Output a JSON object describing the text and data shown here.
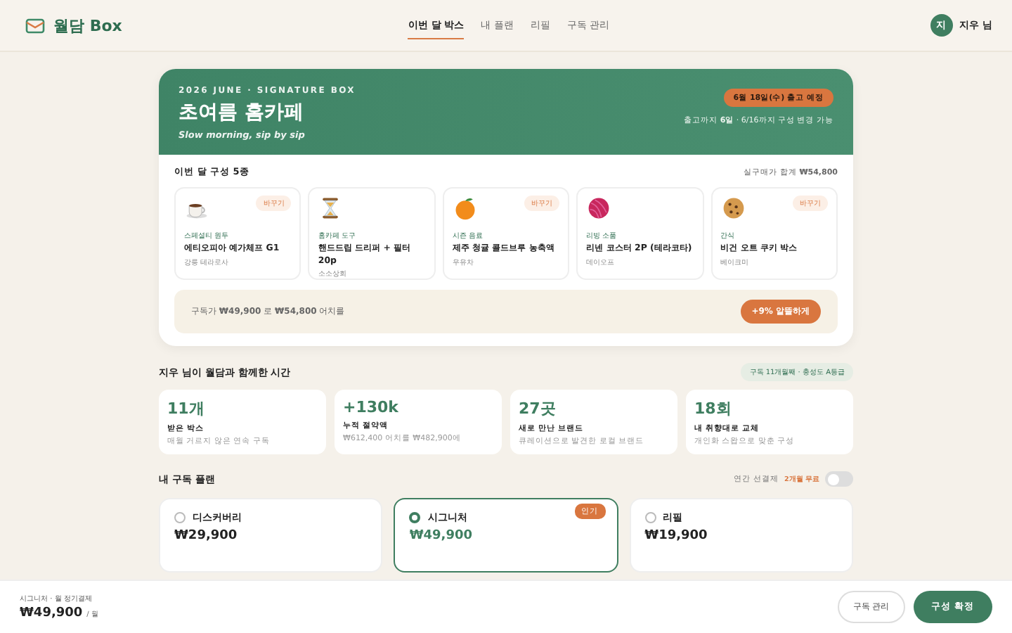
{
  "header": {
    "logo": "월담 Box",
    "nav": [
      {
        "label": "이번 달 박스",
        "selected": true
      },
      {
        "label": "내 플랜",
        "selected": false
      },
      {
        "label": "리필",
        "selected": false
      },
      {
        "label": "구독 관리",
        "selected": false
      }
    ],
    "user": {
      "initial": "지",
      "name": "지우 님"
    }
  },
  "hero": {
    "eyebrow": "2026 JUNE · SIGNATURE BOX",
    "title": "초여름 홈카페",
    "subtitle": "Slow morning, sip by sip",
    "ship_badge": "6월 18일(수) 출고 예정",
    "deadline": "출고까지 **6일** · 6/16까지 구성 변경 가능"
  },
  "box": {
    "heading": "이번 달 구성 5종",
    "total": "실구매가 합계 **₩54,800**",
    "items": [
      {
        "kind": "cup",
        "category": "스페셜티 원두",
        "name": "에티오피아 예가체프 G1",
        "maker": "강릉 테라로사",
        "swap": "바꾸기"
      },
      {
        "kind": "hourglass",
        "category": "홈카페 도구",
        "name": "핸드드립 드리퍼 + 필터 20p",
        "maker": "소소상회"
      },
      {
        "kind": "orange",
        "category": "시즌 음료",
        "name": "제주 청귤 콜드브루 농축액",
        "maker": "우유차",
        "swap": "바꾸기"
      },
      {
        "kind": "yarn",
        "category": "리빙 소품",
        "name": "리넨 코스터 2P (테라코타)",
        "maker": "데이오프"
      },
      {
        "kind": "cookie",
        "category": "간식",
        "name": "비건 오트 쿠키 박스",
        "maker": "베이크미",
        "swap": "바꾸기"
      }
    ],
    "summary": "구독가 **₩49,900** 로 **₩54,800** 어치를",
    "saving": "+9% 알뜰하게"
  },
  "stats": {
    "heading": "지우 님이 월담과 함께한 시간",
    "badge": "구독 11개월째 · 충성도 A등급",
    "cards": [
      {
        "value": "11개",
        "label": "받은 박스",
        "note": "매월 거르지 않은 연속 구독"
      },
      {
        "value": "+130k",
        "label": "누적 절약액",
        "note": "₩612,400 어치를 ₩482,900에"
      },
      {
        "value": "27곳",
        "label": "새로 만난 브랜드",
        "note": "큐레이션으로 발견한 로컬 브랜드"
      },
      {
        "value": "18회",
        "label": "내 취향대로 교체",
        "note": "개인화 스왑으로 맞춘 구성"
      }
    ]
  },
  "plans": {
    "heading": "내 구독 플랜",
    "annual_label": "연간 선결제",
    "annual_badge": "2개월 무료",
    "annual_on": false,
    "items": [
      {
        "name": "디스커버리",
        "price": "₩29,900",
        "selected": false
      },
      {
        "name": "시그니처",
        "price": "₩49,900",
        "selected": true,
        "badge": "인기"
      },
      {
        "name": "리필",
        "price": "₩19,900",
        "selected": false
      }
    ]
  },
  "footer": {
    "caption": "시그니처 · 월 정기결제",
    "price": "₩49,900",
    "unit": "/ 월",
    "secondary": "구독 관리",
    "primary": "구성 확정"
  }
}
